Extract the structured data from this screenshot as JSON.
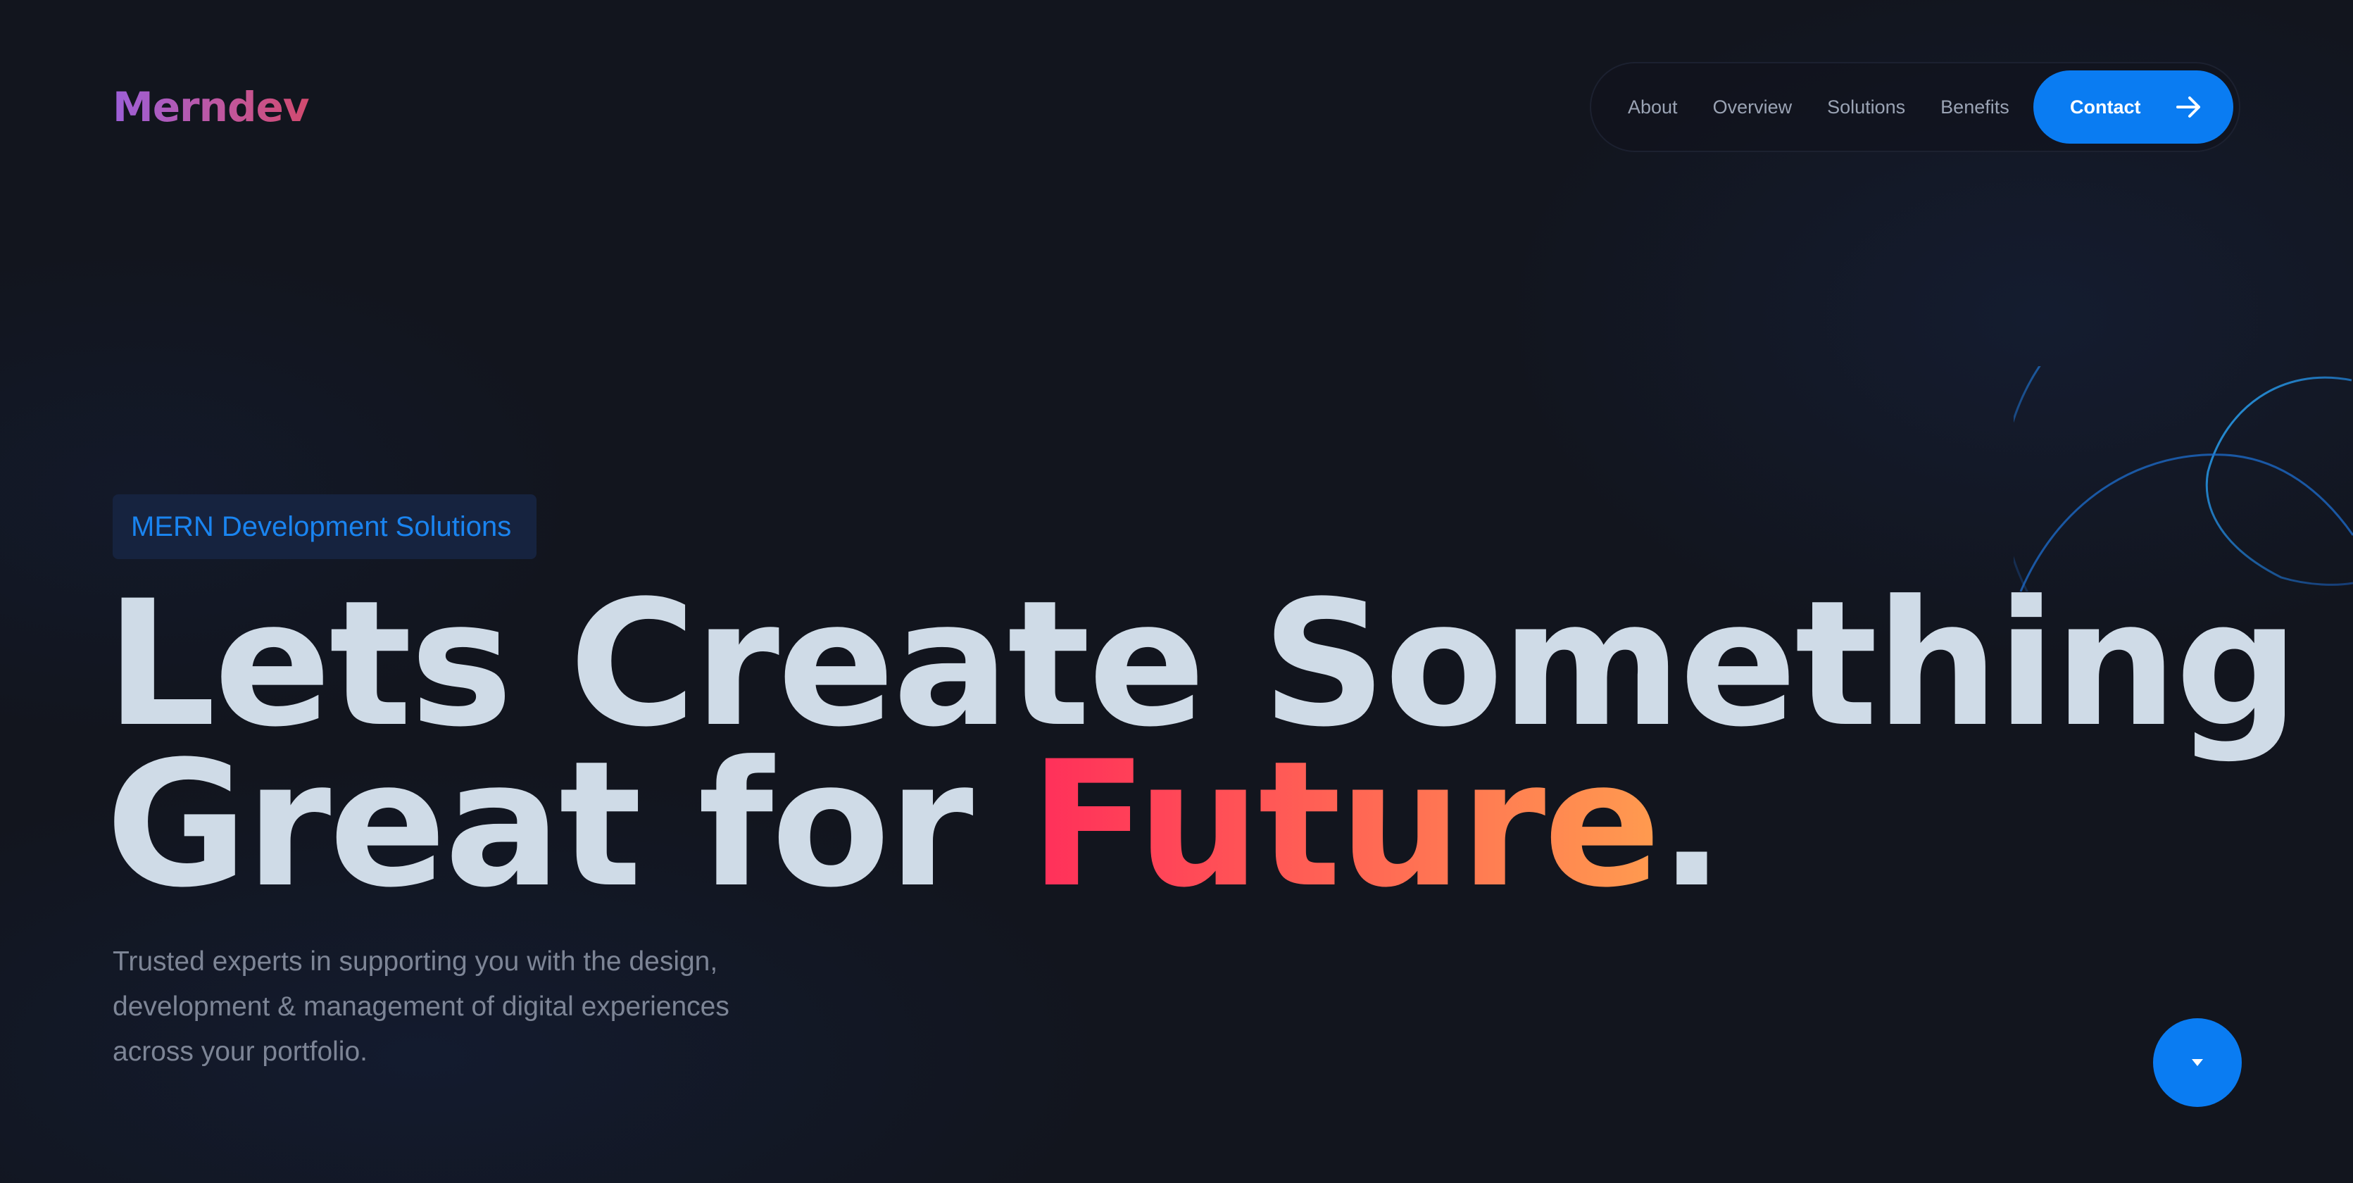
{
  "brand": {
    "logo_text": "Merndev"
  },
  "nav": {
    "items": [
      {
        "label": "About"
      },
      {
        "label": "Overview"
      },
      {
        "label": "Solutions"
      },
      {
        "label": "Benefits"
      }
    ],
    "contact_label": "Contact",
    "contact_icon": "arrow-right-icon"
  },
  "hero": {
    "badge": "MERN Development Solutions",
    "headline_line1": "Lets Create Something",
    "headline_line2_prefix": "Great for ",
    "headline_accent": "Future",
    "headline_suffix": ".",
    "subtext": "Trusted experts in supporting you with the design, development & management of digital experiences across your portfolio."
  },
  "scroll": {
    "icon": "caret-down-icon"
  },
  "colors": {
    "background": "#12151e",
    "primary": "#0a7cf2",
    "headline": "#cfdbe7",
    "accent_start": "#ff2e5a",
    "accent_end": "#ff9b4f",
    "logo_start": "#9c5fd8",
    "logo_end": "#d24a6e"
  }
}
